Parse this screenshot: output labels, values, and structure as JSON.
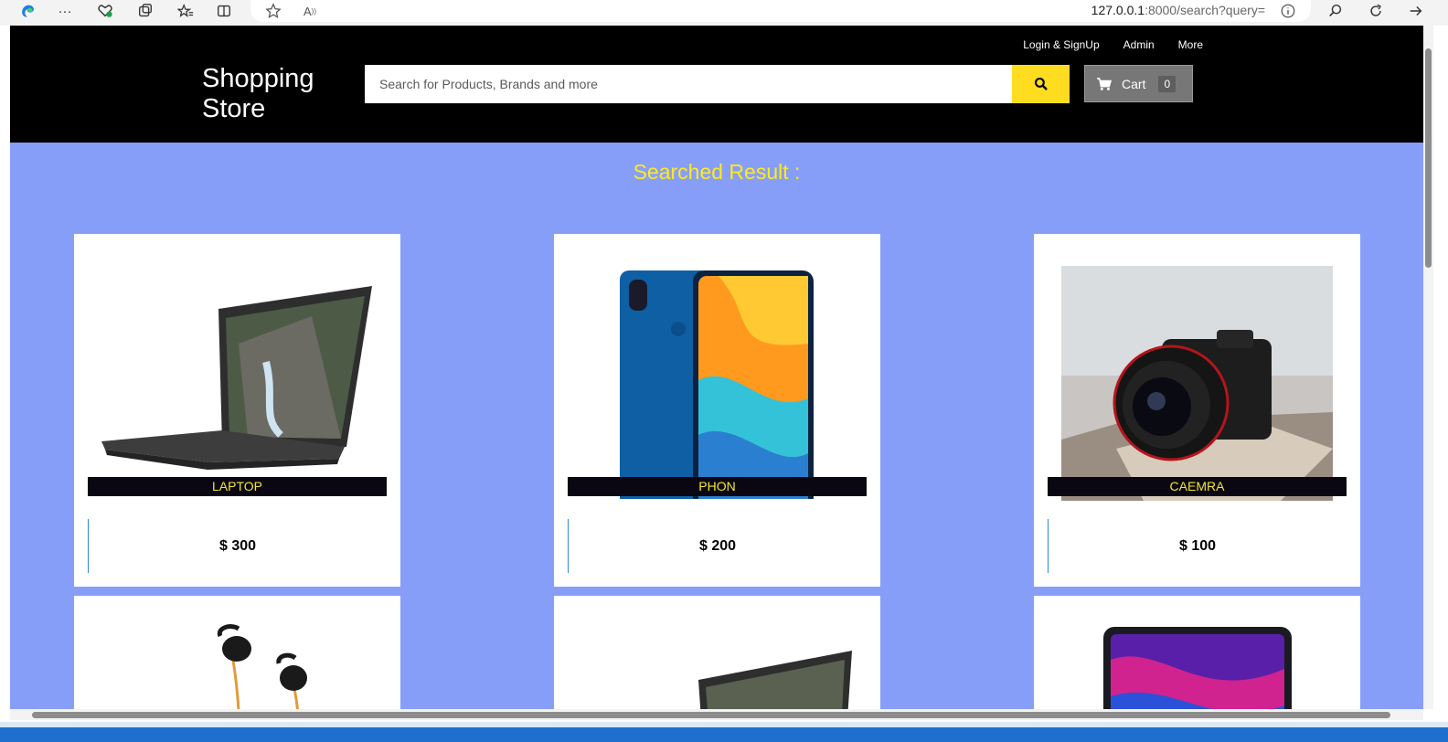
{
  "browser": {
    "url_host": "127.0.0.1",
    "url_rest": ":8000/search?query=",
    "icons": [
      "edge-logo-icon",
      "more-icon",
      "health-icon",
      "tab-actions-icon",
      "favorites-icon",
      "split-screen-icon",
      "star-icon",
      "read-aloud-icon",
      "info-icon",
      "search-icon",
      "refresh-icon",
      "forward-icon"
    ]
  },
  "header": {
    "brand": "Shopping Store",
    "links": [
      "Login & SignUp",
      "Admin",
      "More"
    ],
    "search_placeholder": "Search for Products, Brands and more",
    "cart_label": "Cart",
    "cart_count": "0"
  },
  "results_heading": "Searched Result :",
  "products": [
    {
      "name": "LAPTOP",
      "price": "$ 300",
      "image": "laptop"
    },
    {
      "name": "PHON",
      "price": "$ 200",
      "image": "phone"
    },
    {
      "name": "CAEMRA",
      "price": "$ 100",
      "image": "camera"
    },
    {
      "name": "",
      "price": "",
      "image": "earphones"
    },
    {
      "name": "",
      "price": "",
      "image": "laptop"
    },
    {
      "name": "",
      "price": "",
      "image": "tablet"
    }
  ],
  "colors": {
    "header_bg": "#000000",
    "page_bg": "#879ef9",
    "accent_yellow": "#fedc1f",
    "heading_yellow": "#ffeb1a",
    "cart_bg": "#777777"
  }
}
